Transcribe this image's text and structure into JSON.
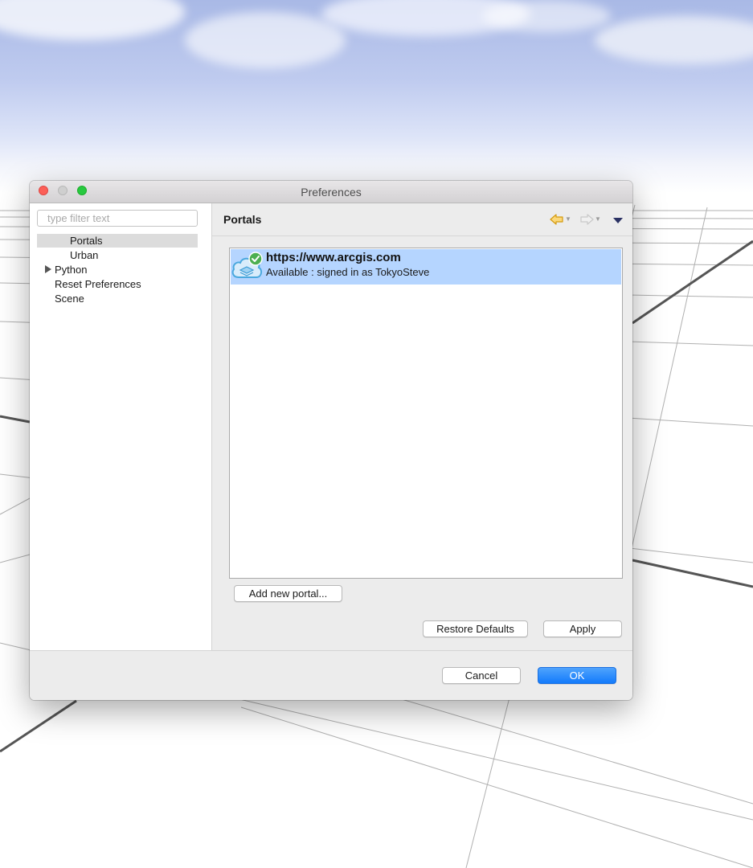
{
  "window": {
    "title": "Preferences"
  },
  "sidebar": {
    "filter_placeholder": "type filter text",
    "items": [
      {
        "label": "Portals",
        "selected": true,
        "level": 1
      },
      {
        "label": "Urban",
        "selected": false,
        "level": 1
      },
      {
        "label": "Python",
        "selected": false,
        "level": 0,
        "expandable": true
      },
      {
        "label": "Reset Preferences",
        "selected": false,
        "level": 0
      },
      {
        "label": "Scene",
        "selected": false,
        "level": 0
      }
    ]
  },
  "page": {
    "title": "Portals",
    "back_icon": "back-arrow-icon",
    "forward_icon": "forward-arrow-icon",
    "menu_icon": "view-menu-icon"
  },
  "portals": [
    {
      "url": "https://www.arcgis.com",
      "status": "Available : signed in as TokyoSteve",
      "icon": "arcgis-cloud-icon",
      "badge_icon": "checkmark-badge-icon"
    }
  ],
  "buttons": {
    "add_portal": "Add new portal...",
    "restore_defaults": "Restore Defaults",
    "apply": "Apply",
    "cancel": "Cancel",
    "ok": "OK"
  },
  "colors": {
    "selection": "#b5d5ff",
    "primary_button": "#137bfb",
    "nav_arrow": "#e3a617",
    "close": "#fc5f57",
    "maximize": "#27c93f"
  }
}
